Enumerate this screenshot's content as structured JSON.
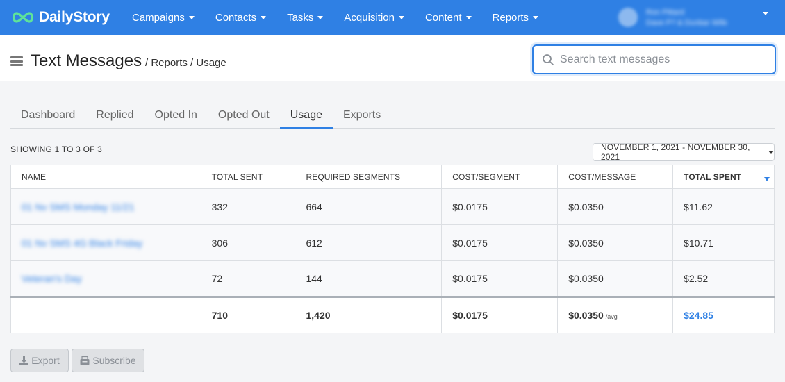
{
  "brand": {
    "name": "DailyStory",
    "accent": "#2f80e4"
  },
  "nav": {
    "items": [
      {
        "label": "Campaigns"
      },
      {
        "label": "Contacts"
      },
      {
        "label": "Tasks"
      },
      {
        "label": "Acquisition"
      },
      {
        "label": "Content"
      },
      {
        "label": "Reports"
      }
    ],
    "user": {
      "name": "Ron Pittard",
      "org": "Dave P? & Dunbar Wife"
    }
  },
  "header": {
    "title": "Text Messages",
    "breadcrumb": "/ Reports / Usage",
    "search": {
      "placeholder": "Search text messages",
      "value": ""
    }
  },
  "tabs": [
    {
      "label": "Dashboard",
      "active": false
    },
    {
      "label": "Replied",
      "active": false
    },
    {
      "label": "Opted In",
      "active": false
    },
    {
      "label": "Opted Out",
      "active": false
    },
    {
      "label": "Usage",
      "active": true
    },
    {
      "label": "Exports",
      "active": false
    }
  ],
  "summary": {
    "showing": "SHOWING 1 TO 3 OF 3",
    "date_range": "NOVEMBER 1, 2021 - NOVEMBER 30, 2021"
  },
  "table": {
    "columns": [
      "NAME",
      "TOTAL SENT",
      "REQUIRED SEGMENTS",
      "COST/SEGMENT",
      "COST/MESSAGE",
      "TOTAL SPENT"
    ],
    "sorted_column": "TOTAL SPENT",
    "rows": [
      {
        "name": "01 Nv SMS Monday 11/21",
        "total_sent": "332",
        "segments": "664",
        "cost_segment": "$0.0175",
        "cost_message": "$0.0350",
        "total_spent": "$11.62"
      },
      {
        "name": "01 Nv SMS 4G Black Friday",
        "total_sent": "306",
        "segments": "612",
        "cost_segment": "$0.0175",
        "cost_message": "$0.0350",
        "total_spent": "$10.71"
      },
      {
        "name": "Veteran's Day",
        "total_sent": "72",
        "segments": "144",
        "cost_segment": "$0.0175",
        "cost_message": "$0.0350",
        "total_spent": "$2.52"
      }
    ],
    "totals": {
      "total_sent": "710",
      "segments": "1,420",
      "cost_segment": "$0.0175",
      "cost_message": "$0.0350",
      "cost_message_suffix": "/avg",
      "total_spent": "$24.85"
    }
  },
  "actions": {
    "export_label": "Export",
    "subscribe_label": "Subscribe"
  }
}
